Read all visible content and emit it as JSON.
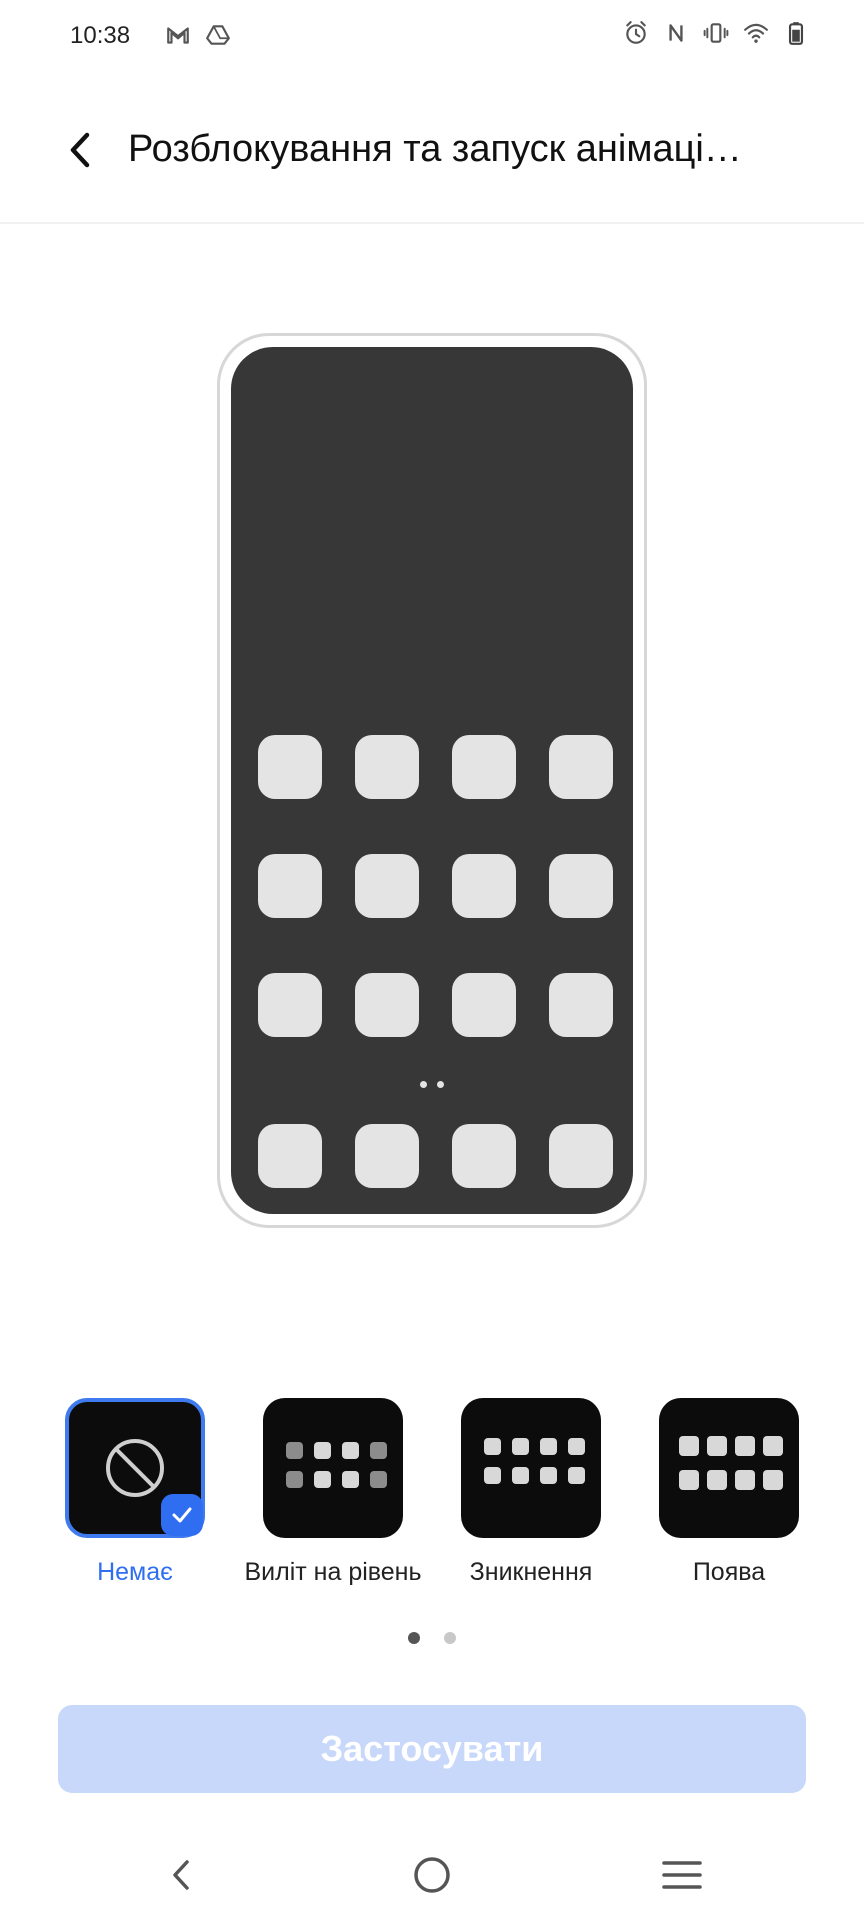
{
  "status_bar": {
    "time": "10:38",
    "left_icons": [
      "gmail-icon",
      "drive-icon"
    ],
    "right_icons": [
      "alarm-icon",
      "nfc-icon",
      "vibrate-icon",
      "wifi-icon",
      "battery-icon"
    ]
  },
  "header": {
    "title": "Розблокування та запуск анімаці…",
    "back_icon": "chevron-left-icon"
  },
  "preview": {
    "app_rows": 3,
    "app_cols": 4,
    "dock_count": 4,
    "page_dots": 2
  },
  "options": [
    {
      "label": "Немає",
      "icon": "none-circle-icon",
      "selected": true
    },
    {
      "label": "Виліт на рівень",
      "icon": "fly-in-grid-icon",
      "selected": false
    },
    {
      "label": "Зникнення",
      "icon": "fade-out-grid-icon",
      "selected": false
    },
    {
      "label": "Поява",
      "icon": "appear-grid-icon",
      "selected": false
    }
  ],
  "pager": {
    "count": 2,
    "active_index": 0
  },
  "apply_button": {
    "label": "Застосувати",
    "enabled": false
  },
  "colors": {
    "accent": "#2f6ef0",
    "apply_disabled_bg": "#c8d8fa",
    "preview_screen": "#373737"
  },
  "nav_bar": {
    "items": [
      "back-icon",
      "home-icon",
      "recents-icon"
    ]
  }
}
